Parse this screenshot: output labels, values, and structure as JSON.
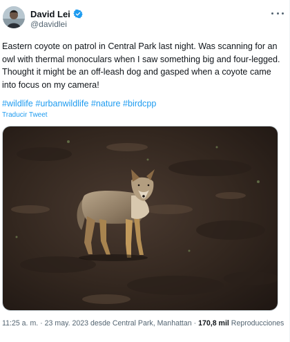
{
  "author": {
    "display_name": "David Lei",
    "handle": "@davidlei",
    "verified": true,
    "avatar_icon": "profile-photo"
  },
  "tweet": {
    "text": "Eastern coyote on patrol in Central Park last night. Was scanning for an owl with thermal monoculars when I saw something big and four-legged. Thought it might be an off-leash dog and gasped when a coyote came into focus on my camera!",
    "hashtags": [
      "#wildlife",
      "#urbanwildlife",
      "#nature",
      "#birdcpp"
    ],
    "translate_label": "Traducir Tweet"
  },
  "media": {
    "subject": "coyote-photo"
  },
  "meta": {
    "time": "11:25 a. m.",
    "separator": " · ",
    "date": "23 may. 2023",
    "from_prefix": " desde ",
    "location": "Central Park, Manhattan",
    "views_count": "170,8 mil",
    "views_label": " Reproducciones"
  },
  "colors": {
    "link": "#1d9bf0",
    "secondary_text": "#536471",
    "verified": "#1d9bf0"
  }
}
